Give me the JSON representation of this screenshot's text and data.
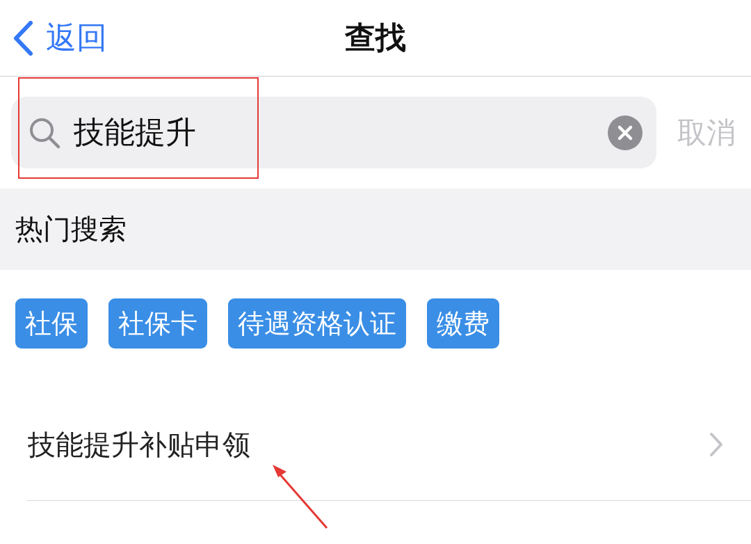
{
  "nav": {
    "back": "返回",
    "title": "查找"
  },
  "search": {
    "value": "技能提升",
    "cancel": "取消"
  },
  "hot": {
    "title": "热门搜索",
    "tags": [
      "社保",
      "社保卡",
      "待遇资格认证",
      "缴费"
    ]
  },
  "results": [
    {
      "label": "技能提升补贴申领"
    }
  ]
}
